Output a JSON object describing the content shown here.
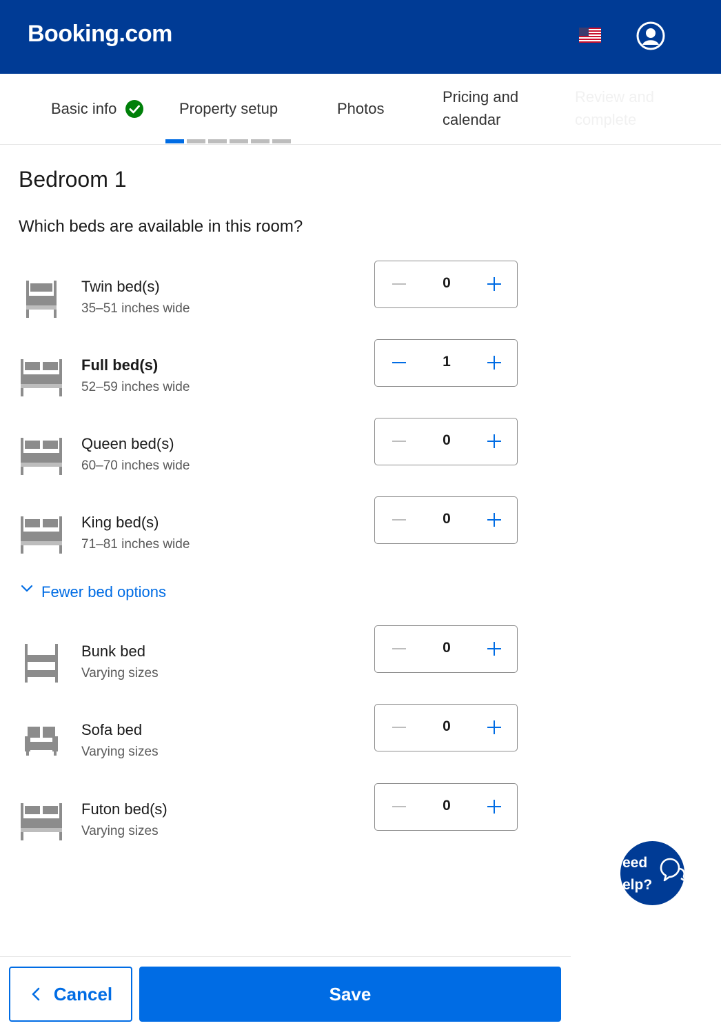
{
  "header": {
    "logo": "Booking.com",
    "flag": "us-flag-icon",
    "account": "user-account-icon",
    "color": "#003b95"
  },
  "tabs": {
    "basic_info": "Basic info",
    "property_setup": "Property setup",
    "photos": "Photos",
    "pricing": "Pricing and calendar",
    "review": "Review and complete",
    "active_step_segment": 1,
    "total_step_segments": 6
  },
  "main": {
    "title": "Bedroom 1",
    "question": "Which beds are available in this room?",
    "beds": [
      {
        "name": "Twin bed(s)",
        "size": "35–51 inches wide",
        "count": "0",
        "icon": "twin-bed-icon"
      },
      {
        "name": "Full bed(s)",
        "size": "52–59 inches wide",
        "count": "1",
        "icon": "full-bed-icon"
      },
      {
        "name": "Queen bed(s)",
        "size": "60–70 inches wide",
        "count": "0",
        "icon": "queen-bed-icon"
      },
      {
        "name": "King bed(s)",
        "size": "71–81 inches wide",
        "count": "0",
        "icon": "king-bed-icon"
      }
    ],
    "fewer_options": "Fewer bed options",
    "more_beds": [
      {
        "name": "Bunk bed",
        "size": "Varying sizes",
        "count": "0",
        "icon": "bunk-bed-icon"
      },
      {
        "name": "Sofa bed",
        "size": "Varying sizes",
        "count": "0",
        "icon": "sofa-bed-icon"
      },
      {
        "name": "Futon bed(s)",
        "size": "Varying sizes",
        "count": "0",
        "icon": "futon-bed-icon"
      }
    ]
  },
  "help": {
    "text": "eed\nelp?"
  },
  "footer": {
    "cancel": "Cancel",
    "save": "Save"
  },
  "colors": {
    "brand_dark": "#003b95",
    "accent": "#006ce4",
    "success": "#008009"
  }
}
